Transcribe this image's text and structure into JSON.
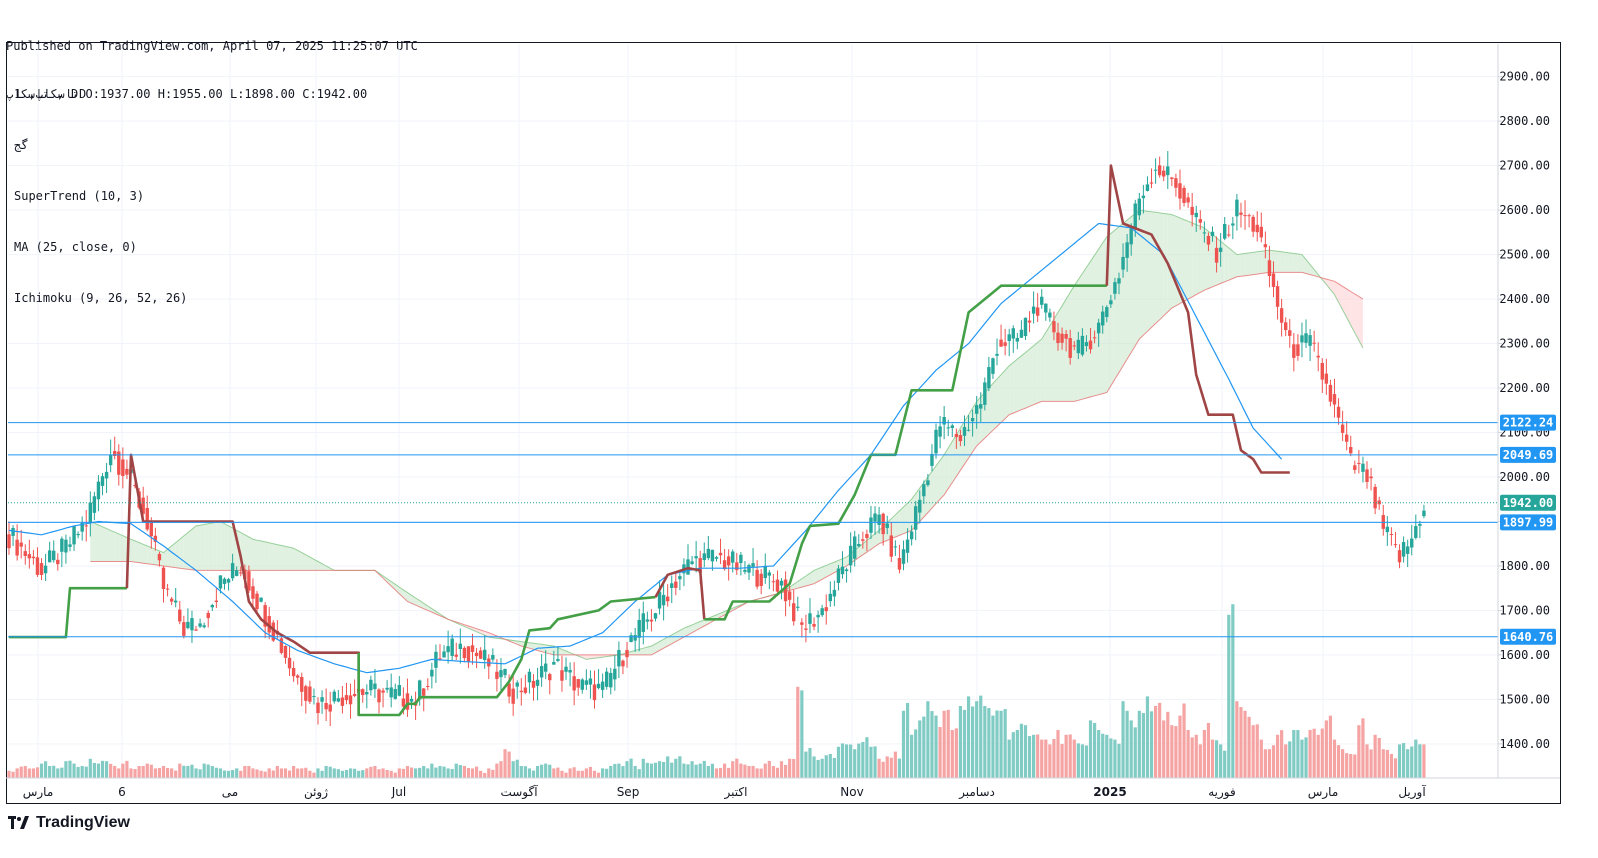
{
  "header": {
    "published": "Published on TradingView.com, April 07, 2025 11:25:07 UTC",
    "ohlc": "تاسکاپ , D O:1937.00 H:1955.00 L:1898.00 C:1942.00"
  },
  "legend": {
    "symbol": "تاسکاپ, 1D",
    "subtitle": "گج",
    "indicators": [
      "SuperTrend (10, 3)",
      "MA (25, close, 0)",
      "Ichimoku (9, 26, 52, 26)"
    ]
  },
  "brand": "TradingView",
  "colors": {
    "up": "#26a69a",
    "down": "#ef5350",
    "supertrend_up": "#43a047",
    "supertrend_down": "#a04545",
    "ma": "#2196f3",
    "hline": "#2196f3",
    "price_label_bg": "#2196f3",
    "cloud_bull": "#c8e6c9",
    "cloud_bear": "#ffcdd2"
  },
  "chart_data": {
    "type": "candlestick",
    "ylim": [
      1330,
      2960
    ],
    "y_ticks": [
      1400,
      1500,
      1600,
      1700,
      1800,
      1900,
      2000,
      2100,
      2200,
      2300,
      2400,
      2500,
      2600,
      2700,
      2800,
      2900
    ],
    "x_labels": [
      "مارس",
      "6",
      "می",
      "ژوئن",
      "Jul",
      "آگوست",
      "Sep",
      "اکتبر",
      "Nov",
      "دسامبر",
      "2025",
      "فوریه",
      "مارس",
      "آوریل"
    ],
    "x_label_bold": "2025",
    "horizontal_lines": [
      2122.24,
      2049.69,
      1897.99,
      1640.76
    ],
    "current_price": 1942.0,
    "last_ohlc": {
      "open": 1937.0,
      "high": 1955.0,
      "low": 1898.0,
      "close": 1942.0
    },
    "close_path": [
      [
        0,
        1870
      ],
      [
        8,
        1790
      ],
      [
        14,
        1840
      ],
      [
        19,
        1900
      ],
      [
        25,
        2060
      ],
      [
        29,
        2010
      ],
      [
        34,
        1900
      ],
      [
        38,
        1750
      ],
      [
        43,
        1660
      ],
      [
        47,
        1670
      ],
      [
        52,
        1760
      ],
      [
        57,
        1800
      ],
      [
        62,
        1710
      ],
      [
        66,
        1640
      ],
      [
        70,
        1560
      ],
      [
        76,
        1490
      ],
      [
        82,
        1510
      ],
      [
        88,
        1520
      ],
      [
        94,
        1510
      ],
      [
        100,
        1500
      ],
      [
        106,
        1600
      ],
      [
        112,
        1620
      ],
      [
        118,
        1580
      ],
      [
        124,
        1520
      ],
      [
        129,
        1540
      ],
      [
        134,
        1580
      ],
      [
        140,
        1530
      ],
      [
        146,
        1520
      ],
      [
        152,
        1620
      ],
      [
        158,
        1690
      ],
      [
        163,
        1760
      ],
      [
        168,
        1810
      ],
      [
        174,
        1820
      ],
      [
        179,
        1800
      ],
      [
        185,
        1780
      ],
      [
        190,
        1760
      ],
      [
        195,
        1660
      ],
      [
        200,
        1700
      ],
      [
        205,
        1790
      ],
      [
        210,
        1870
      ],
      [
        214,
        1910
      ],
      [
        219,
        1800
      ],
      [
        224,
        1950
      ],
      [
        229,
        2120
      ],
      [
        234,
        2090
      ],
      [
        239,
        2170
      ],
      [
        243,
        2300
      ],
      [
        248,
        2310
      ],
      [
        253,
        2390
      ],
      [
        258,
        2320
      ],
      [
        263,
        2280
      ],
      [
        268,
        2340
      ],
      [
        273,
        2460
      ],
      [
        278,
        2630
      ],
      [
        282,
        2700
      ],
      [
        287,
        2660
      ],
      [
        292,
        2570
      ],
      [
        297,
        2510
      ],
      [
        302,
        2600
      ],
      [
        307,
        2560
      ],
      [
        311,
        2420
      ],
      [
        315,
        2290
      ],
      [
        320,
        2300
      ],
      [
        325,
        2180
      ],
      [
        330,
        2030
      ],
      [
        334,
        2000
      ],
      [
        338,
        1880
      ],
      [
        342,
        1820
      ],
      [
        345,
        1860
      ],
      [
        348,
        1940
      ]
    ],
    "volume_bars": [
      [
        0,
        0.15
      ],
      [
        2,
        0.2
      ],
      [
        4,
        0.25
      ],
      [
        6,
        0.2
      ],
      [
        8,
        0.3
      ],
      [
        10,
        0.25
      ],
      [
        12,
        0.2
      ],
      [
        14,
        0.35
      ],
      [
        16,
        0.3
      ],
      [
        18,
        0.25
      ],
      [
        20,
        0.4
      ],
      [
        22,
        0.3
      ],
      [
        24,
        0.35
      ],
      [
        26,
        0.25
      ],
      [
        28,
        0.3
      ],
      [
        30,
        0.2
      ],
      [
        32,
        0.25
      ],
      [
        34,
        0.3
      ],
      [
        36,
        0.2
      ],
      [
        38,
        0.25
      ],
      [
        40,
        0.2
      ],
      [
        42,
        0.3
      ],
      [
        44,
        0.25
      ],
      [
        46,
        0.2
      ],
      [
        48,
        0.3
      ],
      [
        50,
        0.25
      ],
      [
        52,
        0.2
      ],
      [
        54,
        0.15
      ],
      [
        56,
        0.2
      ],
      [
        58,
        0.25
      ],
      [
        60,
        0.2
      ],
      [
        62,
        0.15
      ],
      [
        64,
        0.2
      ],
      [
        66,
        0.25
      ],
      [
        68,
        0.2
      ],
      [
        70,
        0.25
      ],
      [
        72,
        0.2
      ],
      [
        74,
        0.15
      ],
      [
        76,
        0.2
      ],
      [
        78,
        0.25
      ],
      [
        80,
        0.2
      ],
      [
        82,
        0.15
      ],
      [
        84,
        0.2
      ],
      [
        86,
        0.15
      ],
      [
        88,
        0.2
      ],
      [
        90,
        0.25
      ],
      [
        92,
        0.2
      ],
      [
        94,
        0.15
      ],
      [
        96,
        0.2
      ],
      [
        98,
        0.25
      ],
      [
        100,
        0.2
      ],
      [
        102,
        0.25
      ],
      [
        104,
        0.3
      ],
      [
        106,
        0.25
      ],
      [
        108,
        0.2
      ],
      [
        110,
        0.3
      ],
      [
        112,
        0.25
      ],
      [
        114,
        0.2
      ],
      [
        116,
        0.15
      ],
      [
        118,
        0.2
      ],
      [
        120,
        0.3
      ],
      [
        122,
        0.6
      ],
      [
        124,
        0.35
      ],
      [
        126,
        0.25
      ],
      [
        128,
        0.2
      ],
      [
        130,
        0.25
      ],
      [
        132,
        0.3
      ],
      [
        134,
        0.2
      ],
      [
        136,
        0.15
      ],
      [
        138,
        0.2
      ],
      [
        140,
        0.15
      ],
      [
        142,
        0.2
      ],
      [
        144,
        0.15
      ],
      [
        146,
        0.2
      ],
      [
        148,
        0.25
      ],
      [
        150,
        0.3
      ],
      [
        152,
        0.35
      ],
      [
        154,
        0.25
      ],
      [
        156,
        0.4
      ],
      [
        158,
        0.3
      ],
      [
        160,
        0.35
      ],
      [
        162,
        0.45
      ],
      [
        164,
        0.4
      ],
      [
        166,
        0.3
      ],
      [
        168,
        0.35
      ],
      [
        170,
        0.3
      ],
      [
        172,
        0.25
      ],
      [
        174,
        0.2
      ],
      [
        176,
        0.3
      ],
      [
        178,
        0.35
      ],
      [
        180,
        0.3
      ],
      [
        182,
        0.25
      ],
      [
        184,
        0.2
      ],
      [
        186,
        0.3
      ],
      [
        188,
        0.25
      ],
      [
        190,
        0.35
      ],
      [
        192,
        0.4
      ],
      [
        194,
        1.9
      ],
      [
        196,
        0.55
      ],
      [
        198,
        0.45
      ],
      [
        200,
        0.4
      ],
      [
        202,
        0.5
      ],
      [
        204,
        0.65
      ],
      [
        206,
        0.7
      ],
      [
        208,
        0.6
      ],
      [
        210,
        0.75
      ],
      [
        212,
        0.65
      ],
      [
        214,
        0.4
      ],
      [
        216,
        0.45
      ],
      [
        218,
        0.55
      ],
      [
        220,
        1.4
      ],
      [
        222,
        0.9
      ],
      [
        224,
        1.2
      ],
      [
        226,
        1.6
      ],
      [
        228,
        1.3
      ],
      [
        230,
        1.4
      ],
      [
        232,
        1.0
      ],
      [
        234,
        1.5
      ],
      [
        236,
        1.7
      ],
      [
        238,
        1.6
      ],
      [
        240,
        1.5
      ],
      [
        242,
        1.3
      ],
      [
        244,
        1.4
      ],
      [
        246,
        0.8
      ],
      [
        248,
        1.0
      ],
      [
        250,
        1.1
      ],
      [
        252,
        0.9
      ],
      [
        254,
        0.8
      ],
      [
        256,
        0.7
      ],
      [
        258,
        1.0
      ],
      [
        260,
        0.9
      ],
      [
        262,
        0.8
      ],
      [
        264,
        0.7
      ],
      [
        266,
        1.2
      ],
      [
        268,
        1.0
      ],
      [
        270,
        0.9
      ],
      [
        272,
        0.8
      ],
      [
        274,
        1.6
      ],
      [
        276,
        1.2
      ],
      [
        278,
        1.4
      ],
      [
        280,
        1.7
      ],
      [
        282,
        1.5
      ],
      [
        284,
        1.2
      ],
      [
        286,
        1.1
      ],
      [
        288,
        1.3
      ],
      [
        290,
        1.0
      ],
      [
        292,
        0.9
      ],
      [
        294,
        1.0
      ],
      [
        296,
        0.8
      ],
      [
        298,
        0.7
      ],
      [
        300,
        3.4
      ],
      [
        302,
        1.6
      ],
      [
        304,
        1.4
      ],
      [
        306,
        1.1
      ],
      [
        308,
        0.8
      ],
      [
        310,
        0.6
      ],
      [
        312,
        0.9
      ],
      [
        314,
        0.7
      ],
      [
        316,
        1.0
      ],
      [
        318,
        0.8
      ],
      [
        320,
        1.0
      ],
      [
        322,
        0.9
      ],
      [
        324,
        1.2
      ],
      [
        326,
        0.8
      ],
      [
        328,
        0.6
      ],
      [
        330,
        0.5
      ],
      [
        332,
        1.1
      ],
      [
        334,
        0.7
      ],
      [
        336,
        0.9
      ],
      [
        338,
        0.6
      ],
      [
        340,
        0.5
      ],
      [
        342,
        0.7
      ],
      [
        344,
        0.6
      ],
      [
        346,
        0.8
      ],
      [
        348,
        0.7
      ]
    ],
    "supertrend": [
      [
        0,
        1640
      ],
      [
        14,
        1640
      ],
      [
        15,
        1750
      ],
      [
        29,
        1750
      ],
      [
        30,
        2050
      ],
      [
        33,
        1900
      ],
      [
        55,
        1900
      ],
      [
        57,
        1820
      ],
      [
        59,
        1720
      ],
      [
        62,
        1680
      ],
      [
        66,
        1650
      ],
      [
        70,
        1630
      ],
      [
        74,
        1605
      ],
      [
        86,
        1605
      ],
      [
        86,
        1465
      ],
      [
        96,
        1465
      ],
      [
        98,
        1490
      ],
      [
        100,
        1490
      ],
      [
        101,
        1505
      ],
      [
        120,
        1505
      ],
      [
        123,
        1540
      ],
      [
        126,
        1590
      ],
      [
        128,
        1655
      ],
      [
        133,
        1660
      ],
      [
        135,
        1680
      ],
      [
        145,
        1700
      ],
      [
        148,
        1720
      ],
      [
        159,
        1730
      ],
      [
        162,
        1780
      ],
      [
        167,
        1795
      ],
      [
        170,
        1790
      ],
      [
        171,
        1680
      ],
      [
        176,
        1680
      ],
      [
        178,
        1720
      ],
      [
        187,
        1720
      ],
      [
        192,
        1760
      ],
      [
        195,
        1850
      ],
      [
        197,
        1890
      ],
      [
        204,
        1895
      ],
      [
        208,
        1960
      ],
      [
        212,
        2050
      ],
      [
        218,
        2050
      ],
      [
        222,
        2195
      ],
      [
        232,
        2195
      ],
      [
        236,
        2370
      ],
      [
        240,
        2400
      ],
      [
        244,
        2430
      ],
      [
        270,
        2430
      ],
      [
        271,
        2700
      ],
      [
        274,
        2570
      ],
      [
        281,
        2545
      ],
      [
        285,
        2480
      ],
      [
        290,
        2370
      ],
      [
        292,
        2230
      ],
      [
        295,
        2140
      ],
      [
        301,
        2140
      ],
      [
        303,
        2060
      ],
      [
        306,
        2040
      ],
      [
        308,
        2010
      ],
      [
        315,
        2010
      ]
    ],
    "supertrend_direction": [
      [
        "up",
        0,
        29
      ],
      [
        "down",
        29,
        86
      ],
      [
        "up",
        86,
        159
      ],
      [
        "down",
        159,
        171
      ],
      [
        "up",
        171,
        270
      ],
      [
        "down",
        270,
        315
      ]
    ],
    "moving_average": [
      [
        0,
        1880
      ],
      [
        8,
        1870
      ],
      [
        16,
        1890
      ],
      [
        22,
        1900
      ],
      [
        30,
        1895
      ],
      [
        38,
        1845
      ],
      [
        46,
        1790
      ],
      [
        55,
        1720
      ],
      [
        63,
        1650
      ],
      [
        71,
        1610
      ],
      [
        80,
        1580
      ],
      [
        88,
        1560
      ],
      [
        96,
        1570
      ],
      [
        104,
        1590
      ],
      [
        112,
        1585
      ],
      [
        122,
        1580
      ],
      [
        130,
        1615
      ],
      [
        138,
        1620
      ],
      [
        146,
        1650
      ],
      [
        154,
        1720
      ],
      [
        162,
        1780
      ],
      [
        170,
        1795
      ],
      [
        180,
        1795
      ],
      [
        188,
        1800
      ],
      [
        196,
        1880
      ],
      [
        204,
        1970
      ],
      [
        212,
        2050
      ],
      [
        220,
        2160
      ],
      [
        228,
        2240
      ],
      [
        236,
        2300
      ],
      [
        244,
        2390
      ],
      [
        252,
        2450
      ],
      [
        260,
        2510
      ],
      [
        268,
        2570
      ],
      [
        276,
        2560
      ],
      [
        284,
        2500
      ],
      [
        292,
        2360
      ],
      [
        300,
        2220
      ],
      [
        306,
        2110
      ],
      [
        313,
        2040
      ]
    ],
    "cloud_span_a": [
      [
        20,
        1900
      ],
      [
        30,
        1860
      ],
      [
        38,
        1830
      ],
      [
        46,
        1890
      ],
      [
        52,
        1900
      ],
      [
        60,
        1860
      ],
      [
        70,
        1840
      ],
      [
        80,
        1790
      ],
      [
        90,
        1790
      ],
      [
        98,
        1740
      ],
      [
        108,
        1680
      ],
      [
        118,
        1640
      ],
      [
        126,
        1630
      ],
      [
        134,
        1620
      ],
      [
        142,
        1590
      ],
      [
        150,
        1600
      ],
      [
        158,
        1620
      ],
      [
        166,
        1660
      ],
      [
        174,
        1690
      ],
      [
        182,
        1720
      ],
      [
        190,
        1740
      ],
      [
        198,
        1790
      ],
      [
        206,
        1820
      ],
      [
        214,
        1880
      ],
      [
        222,
        1950
      ],
      [
        230,
        2050
      ],
      [
        238,
        2170
      ],
      [
        246,
        2250
      ],
      [
        254,
        2310
      ],
      [
        262,
        2430
      ],
      [
        270,
        2540
      ],
      [
        278,
        2600
      ],
      [
        286,
        2590
      ],
      [
        294,
        2560
      ],
      [
        302,
        2500
      ],
      [
        310,
        2510
      ],
      [
        318,
        2500
      ],
      [
        326,
        2410
      ],
      [
        333,
        2290
      ]
    ],
    "cloud_span_b": [
      [
        20,
        1810
      ],
      [
        30,
        1810
      ],
      [
        38,
        1800
      ],
      [
        46,
        1790
      ],
      [
        52,
        1790
      ],
      [
        60,
        1790
      ],
      [
        70,
        1790
      ],
      [
        80,
        1790
      ],
      [
        90,
        1790
      ],
      [
        98,
        1720
      ],
      [
        108,
        1680
      ],
      [
        118,
        1650
      ],
      [
        126,
        1620
      ],
      [
        134,
        1600
      ],
      [
        142,
        1600
      ],
      [
        150,
        1600
      ],
      [
        158,
        1600
      ],
      [
        166,
        1640
      ],
      [
        174,
        1680
      ],
      [
        182,
        1720
      ],
      [
        190,
        1740
      ],
      [
        198,
        1760
      ],
      [
        206,
        1800
      ],
      [
        214,
        1850
      ],
      [
        222,
        1880
      ],
      [
        230,
        1960
      ],
      [
        238,
        2070
      ],
      [
        246,
        2140
      ],
      [
        254,
        2170
      ],
      [
        262,
        2170
      ],
      [
        270,
        2190
      ],
      [
        278,
        2310
      ],
      [
        286,
        2380
      ],
      [
        294,
        2420
      ],
      [
        302,
        2450
      ],
      [
        310,
        2460
      ],
      [
        318,
        2460
      ],
      [
        326,
        2440
      ],
      [
        333,
        2400
      ]
    ]
  }
}
